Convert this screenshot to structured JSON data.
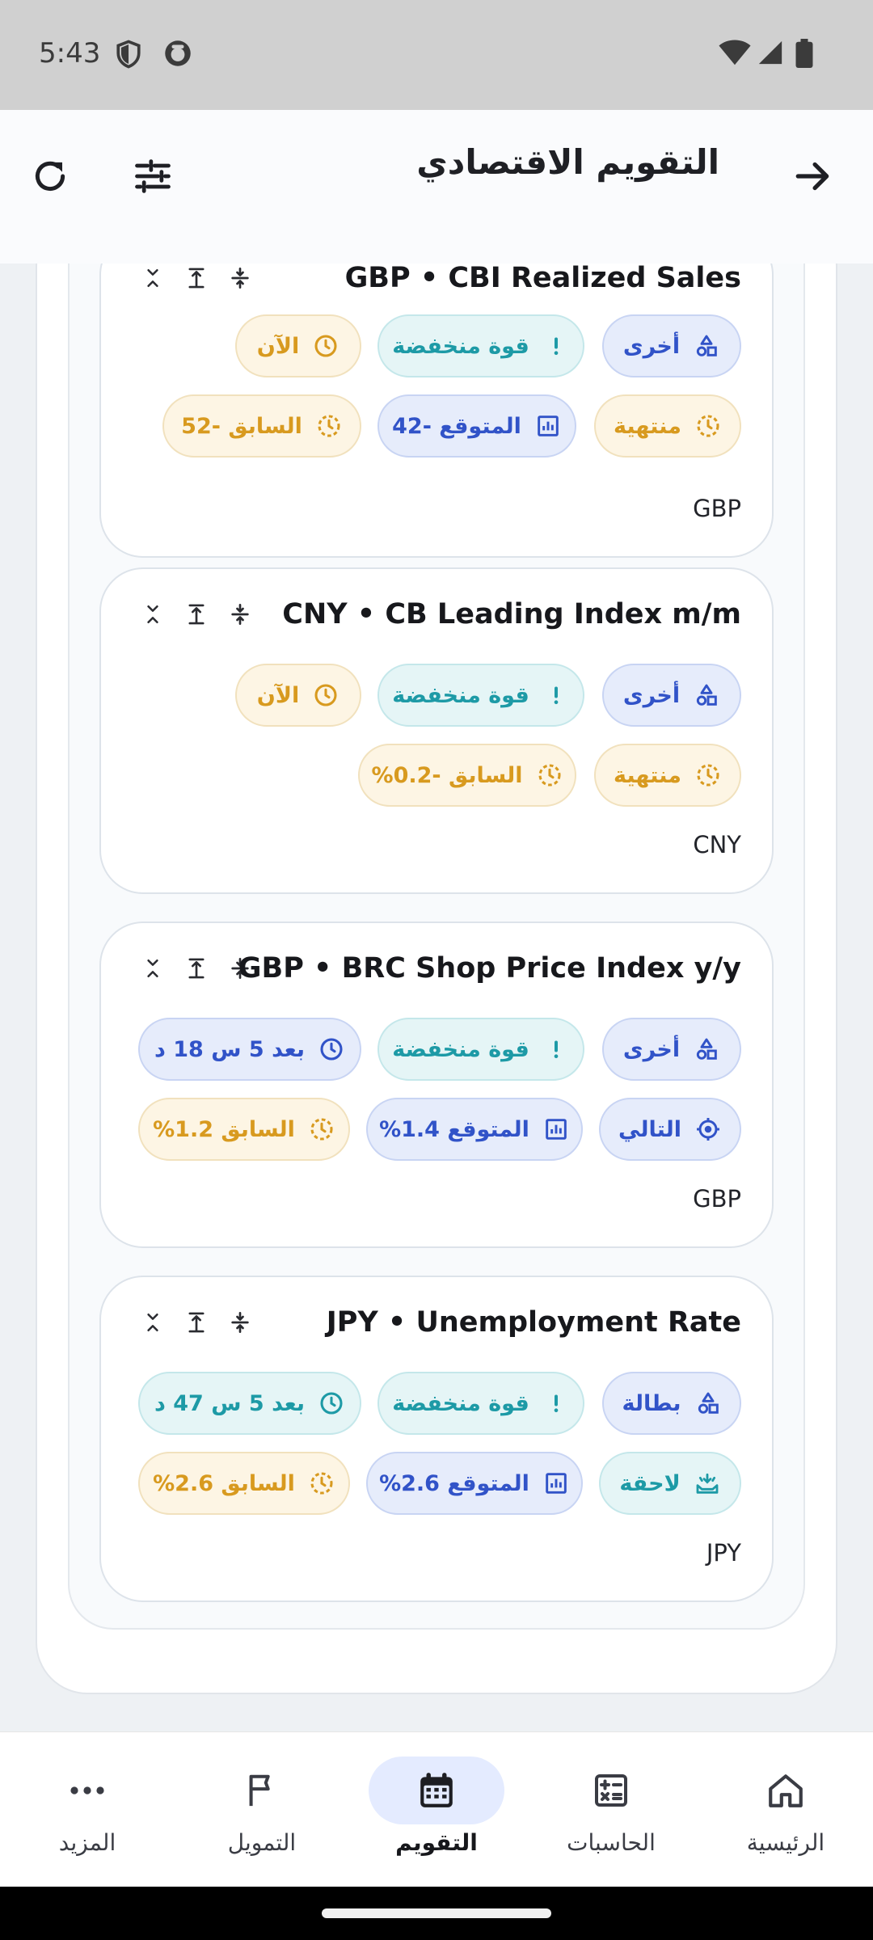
{
  "status_bar": {
    "time": "5:43"
  },
  "app_bar": {
    "title": "التقويم الاقتصادي"
  },
  "events": [
    {
      "title": "GBP • CBI Realized Sales",
      "currency": "GBP",
      "chips": {
        "category": {
          "label": "أخرى",
          "icon": "category-icon"
        },
        "impact": {
          "label": "قوة منخفضة",
          "icon": "exclamation-icon"
        },
        "time": {
          "label": "الآن",
          "icon": "clock-icon"
        },
        "status": {
          "label": "منتهية",
          "icon": "progress-clock-icon"
        },
        "forecast": {
          "label": "المتوقع -42",
          "icon": "chart-box-icon"
        },
        "previous": {
          "label": "السابق -52",
          "icon": "dashed-clock-icon"
        }
      }
    },
    {
      "title": "CNY • CB Leading Index m/m",
      "currency": "CNY",
      "chips": {
        "category": {
          "label": "أخرى",
          "icon": "category-icon"
        },
        "impact": {
          "label": "قوة منخفضة",
          "icon": "exclamation-icon"
        },
        "time": {
          "label": "الآن",
          "icon": "clock-icon"
        },
        "status": {
          "label": "منتهية",
          "icon": "progress-clock-icon"
        },
        "previous": {
          "label": "السابق -0.2%",
          "icon": "dashed-clock-icon"
        }
      }
    },
    {
      "title": "GBP • BRC Shop Price Index y/y",
      "currency": "GBP",
      "chips": {
        "category": {
          "label": "أخرى",
          "icon": "category-icon"
        },
        "impact": {
          "label": "قوة منخفضة",
          "icon": "exclamation-icon"
        },
        "time": {
          "label": "بعد 5 س 18 د",
          "icon": "clock-icon"
        },
        "status": {
          "label": "التالي",
          "icon": "target-icon"
        },
        "forecast": {
          "label": "المتوقع 1.4%",
          "icon": "chart-box-icon"
        },
        "previous": {
          "label": "السابق 1.2%",
          "icon": "dashed-clock-icon"
        }
      }
    },
    {
      "title": "JPY • Unemployment Rate",
      "currency": "JPY",
      "chips": {
        "category": {
          "label": "بطالة",
          "icon": "category-icon"
        },
        "impact": {
          "label": "قوة منخفضة",
          "icon": "exclamation-icon"
        },
        "time": {
          "label": "بعد 5 س 47 د",
          "icon": "clock-icon"
        },
        "status": {
          "label": "لاحقة",
          "icon": "upcoming-icon"
        },
        "forecast": {
          "label": "المتوقع 2.6%",
          "icon": "chart-box-icon"
        },
        "previous": {
          "label": "السابق 2.6%",
          "icon": "dashed-clock-icon"
        }
      }
    }
  ],
  "bottom_nav": {
    "home": "الرئيسية",
    "calculators": "الحاسبات",
    "calendar": "التقويم",
    "funding": "التمويل",
    "more": "المزيد",
    "active": "calendar"
  },
  "colors": {
    "accent_blue": "#3153c8",
    "teal": "#1d9aa6",
    "amber": "#d89a1f",
    "active_nav_bg": "#e4ebff"
  }
}
